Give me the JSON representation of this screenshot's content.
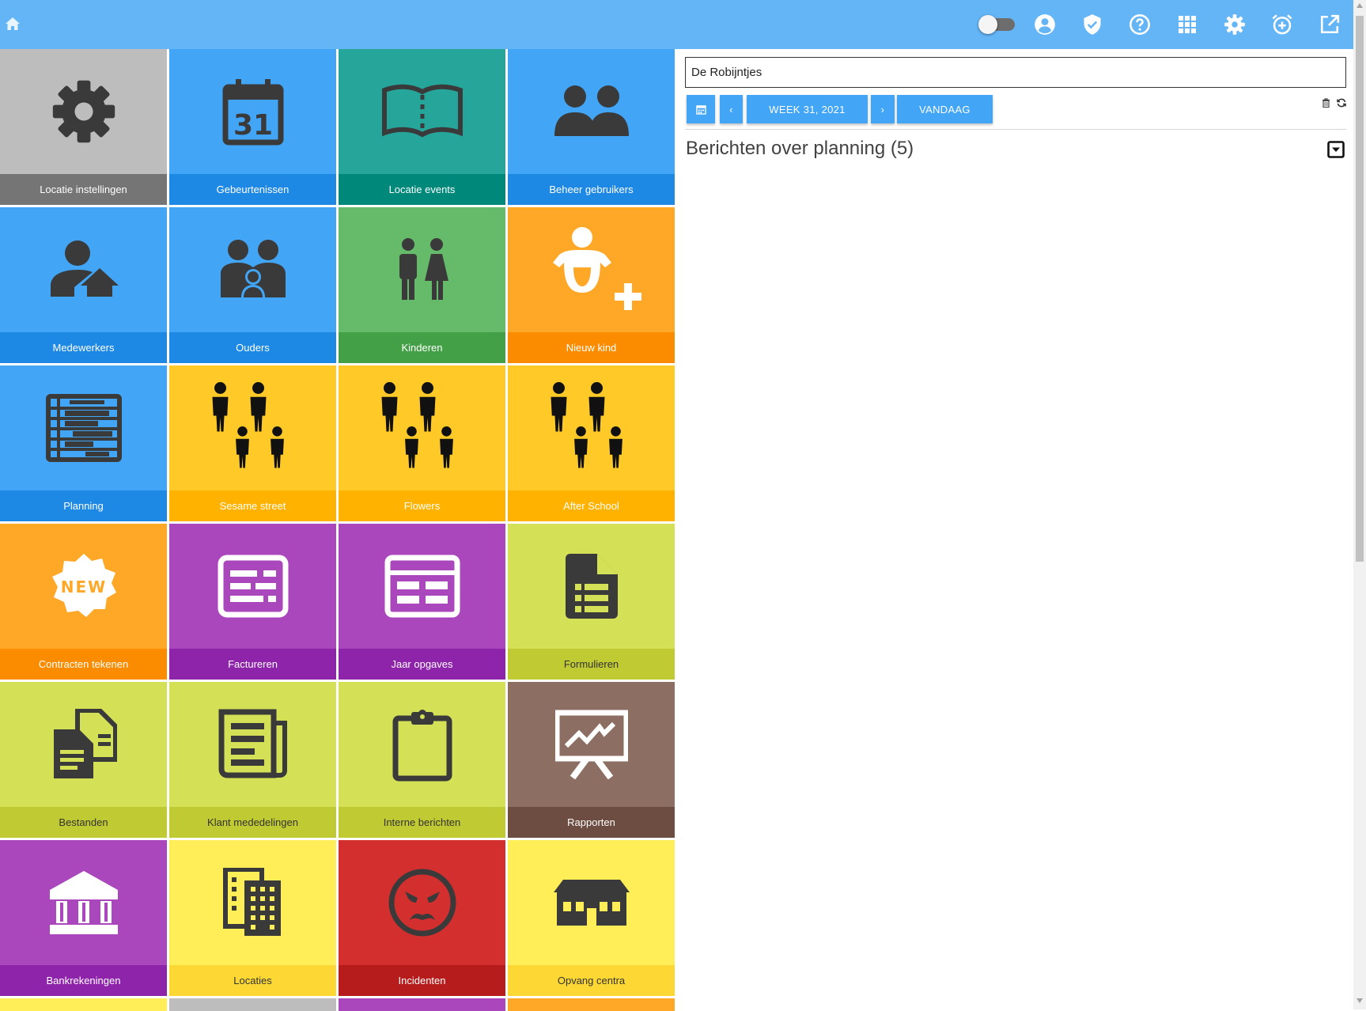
{
  "topbar": {
    "icons": [
      "home-icon",
      "toggle-switch",
      "account-icon",
      "shield-check-icon",
      "help-icon",
      "apps-grid-icon",
      "settings-icon",
      "alarm-add-icon",
      "open-external-icon"
    ],
    "colors": {
      "bar": "#64b5f6"
    }
  },
  "tiles": [
    {
      "label": "Locatie instellingen",
      "icon": "gear-icon",
      "bg": "#bdbdbd",
      "labelBg": "#757575"
    },
    {
      "label": "Gebeurtenissen",
      "icon": "calendar-31-icon",
      "bg": "#42a5f5",
      "labelBg": "#1e88e5",
      "iconText": "31"
    },
    {
      "label": "Locatie events",
      "icon": "open-book-icon",
      "bg": "#26a69a",
      "labelBg": "#00897b"
    },
    {
      "label": "Beheer gebruikers",
      "icon": "users-icon",
      "bg": "#42a5f5",
      "labelBg": "#1e88e5"
    },
    {
      "label": "Medewerkers",
      "icon": "employee-home-icon",
      "bg": "#42a5f5",
      "labelBg": "#1e88e5"
    },
    {
      "label": "Ouders",
      "icon": "parents-icon",
      "bg": "#42a5f5",
      "labelBg": "#1e88e5"
    },
    {
      "label": "Kinderen",
      "icon": "children-icon",
      "bg": "#66bb6a",
      "labelBg": "#43a047"
    },
    {
      "label": "Nieuw kind",
      "icon": "baby-add-icon",
      "bg": "#ffa726",
      "labelBg": "#fb8c00"
    },
    {
      "label": "Planning",
      "icon": "planning-table-icon",
      "bg": "#42a5f5",
      "labelBg": "#1e88e5"
    },
    {
      "label": "Sesame street",
      "icon": "family-group-icon",
      "bg": "#ffca28",
      "labelBg": "#ffb300"
    },
    {
      "label": "Flowers",
      "icon": "family-group-icon",
      "bg": "#ffca28",
      "labelBg": "#ffb300"
    },
    {
      "label": "After School",
      "icon": "family-group-icon",
      "bg": "#ffca28",
      "labelBg": "#ffb300"
    },
    {
      "label": "Contracten tekenen",
      "icon": "new-badge-icon",
      "bg": "#ffa726",
      "labelBg": "#fb8c00",
      "iconText": "NEW"
    },
    {
      "label": "Factureren",
      "icon": "invoice-icon",
      "bg": "#ab47bc",
      "labelBg": "#8e24aa"
    },
    {
      "label": "Jaar opgaves",
      "icon": "annual-statement-icon",
      "bg": "#ab47bc",
      "labelBg": "#8e24aa"
    },
    {
      "label": "Formulieren",
      "icon": "form-document-icon",
      "bg": "#d4e157",
      "labelBg": "#c0ca33",
      "dark": true
    },
    {
      "label": "Bestanden",
      "icon": "files-icon",
      "bg": "#d4e157",
      "labelBg": "#c0ca33",
      "dark": true
    },
    {
      "label": "Klant mededelingen",
      "icon": "newspaper-icon",
      "bg": "#d4e157",
      "labelBg": "#c0ca33",
      "dark": true
    },
    {
      "label": "Interne berichten",
      "icon": "clipboard-icon",
      "bg": "#d4e157",
      "labelBg": "#c0ca33",
      "dark": true
    },
    {
      "label": "Rapporten",
      "icon": "presentation-chart-icon",
      "bg": "#8d6e63",
      "labelBg": "#6d4c41"
    },
    {
      "label": "Bankrekeningen",
      "icon": "bank-icon",
      "bg": "#ab47bc",
      "labelBg": "#8e24aa"
    },
    {
      "label": "Locaties",
      "icon": "office-buildings-icon",
      "bg": "#ffee58",
      "labelBg": "#fdd835",
      "dark": true
    },
    {
      "label": "Incidenten",
      "icon": "angry-face-icon",
      "bg": "#d32f2f",
      "labelBg": "#b71c1c"
    },
    {
      "label": "Opvang centra",
      "icon": "daycare-building-icon",
      "bg": "#ffee58",
      "labelBg": "#fdd835",
      "dark": true
    }
  ],
  "partialRowColors": [
    "#ffee58",
    "#bdbdbd",
    "#ab47bc",
    "#ffa726"
  ],
  "panel": {
    "location": "De Robijntjes",
    "buttons": {
      "calendar": "calendar-icon",
      "prev": "‹",
      "week": "WEEK 31, 2021",
      "next": "›",
      "today": "VANDAAG"
    },
    "small_icons": [
      "trash-icon",
      "refresh-icon"
    ],
    "messages_title": "Berichten over planning (5)",
    "collapse_icon": "collapse-down-icon"
  }
}
